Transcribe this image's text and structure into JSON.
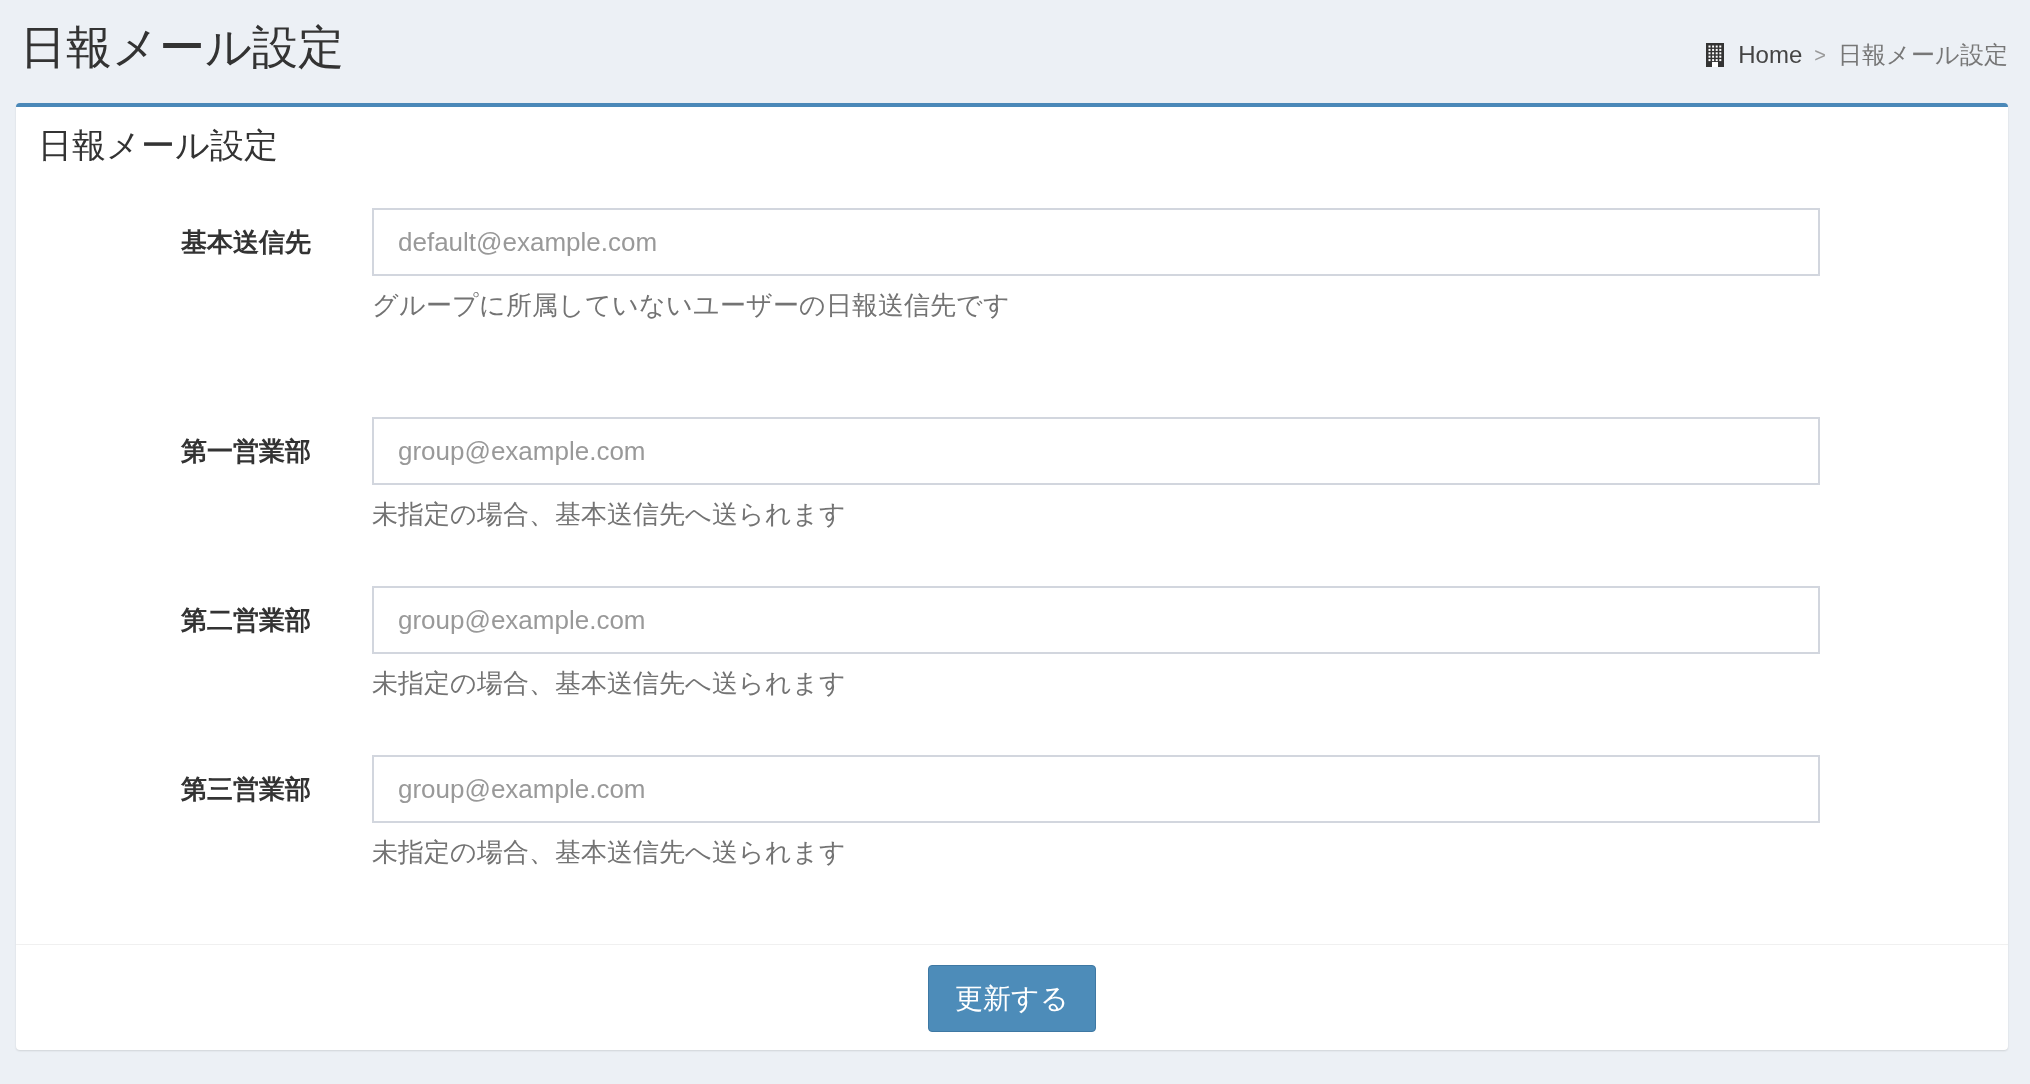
{
  "page_title": "日報メール設定",
  "breadcrumb": [
    {
      "label": "Home",
      "kind": "home"
    },
    {
      "label": "日報メール設定",
      "kind": "current"
    }
  ],
  "breadcrumb_separator": ">",
  "card": {
    "title": "日報メール設定",
    "fields": [
      {
        "label": "基本送信先",
        "placeholder": "default@example.com",
        "help": "グループに所属していないユーザーの日報送信先です"
      },
      {
        "label": "第一営業部",
        "placeholder": "group@example.com",
        "help": "未指定の場合、基本送信先へ送られます"
      },
      {
        "label": "第二営業部",
        "placeholder": "group@example.com",
        "help": "未指定の場合、基本送信先へ送られます"
      },
      {
        "label": "第三営業部",
        "placeholder": "group@example.com",
        "help": "未指定の場合、基本送信先へ送られます"
      }
    ],
    "submit": "更新する"
  }
}
